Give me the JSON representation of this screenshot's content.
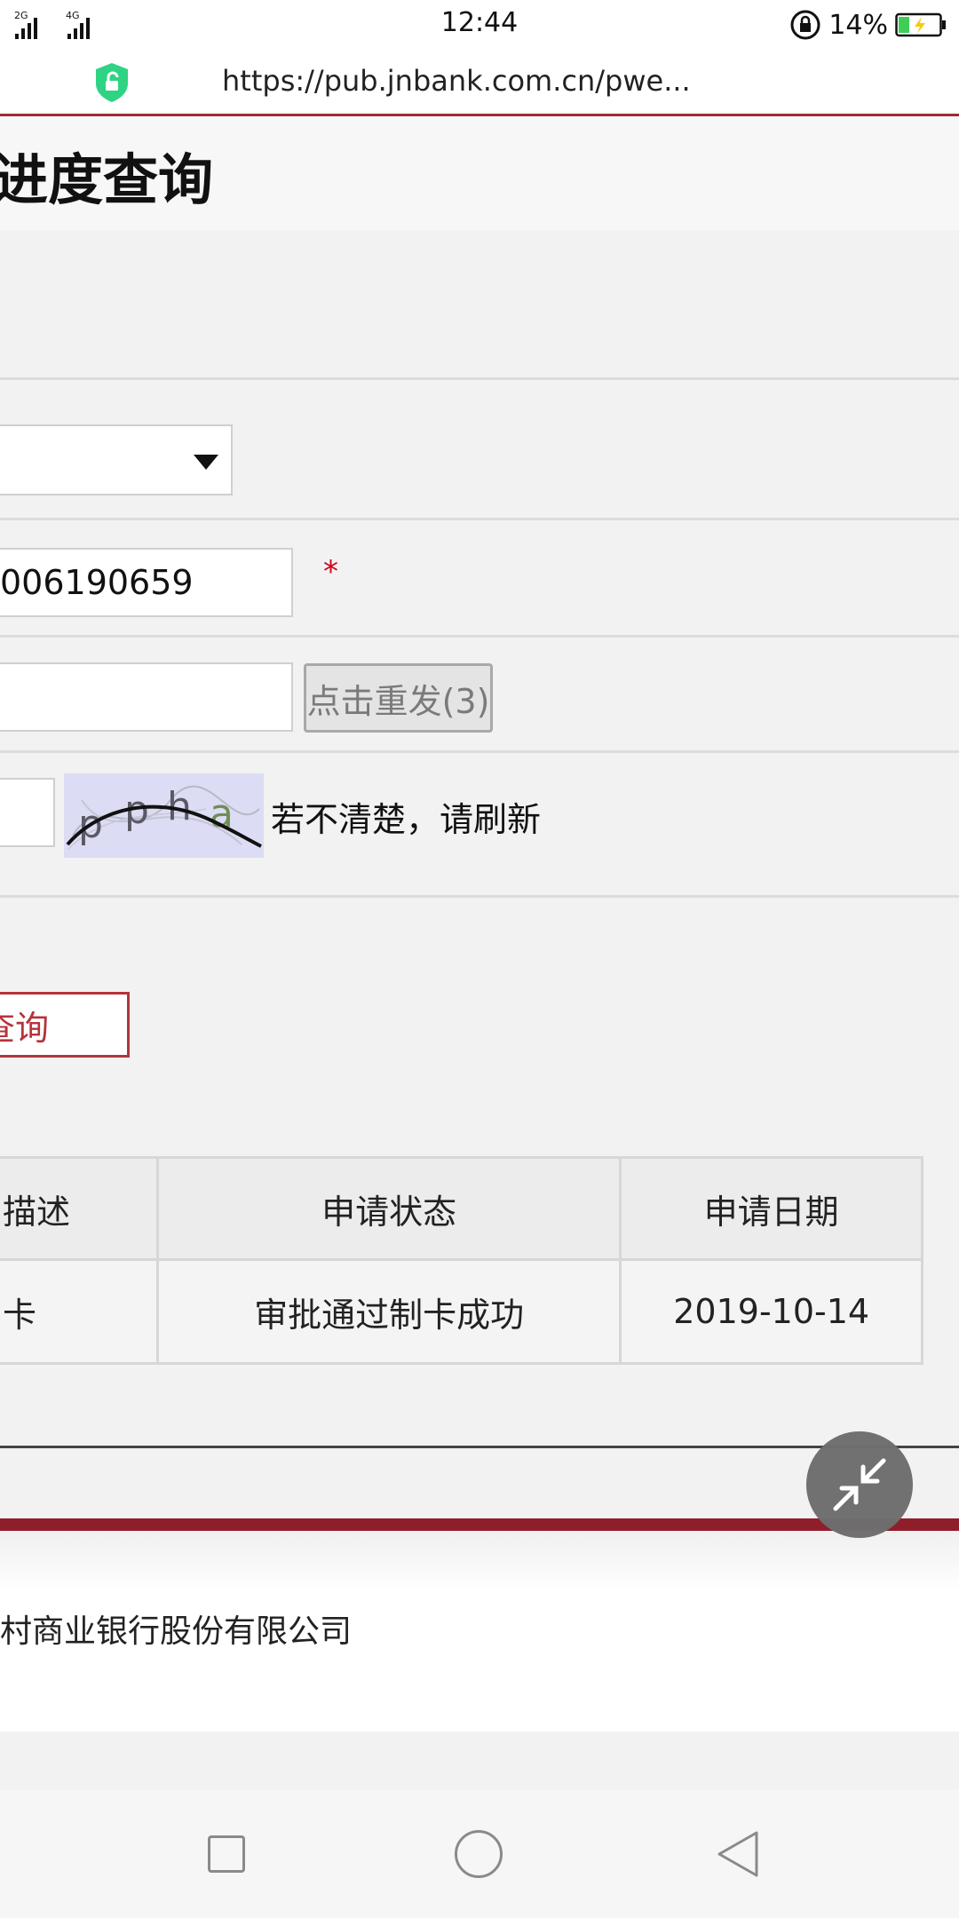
{
  "status_bar": {
    "network_1": "2G",
    "network_2": "4G",
    "time": "12:44",
    "battery_percent": "14%"
  },
  "browser": {
    "url": "https://pub.jnbank.com.cn/pwe..."
  },
  "page": {
    "title": "进度查询",
    "phone_value": "006190659",
    "required_mark": "*",
    "resend_label": "点击重发(3)",
    "refresh_hint": "若不清楚，请刷新",
    "query_label": "查询"
  },
  "table": {
    "headers": [
      "描述",
      "申请状态",
      "申请日期"
    ],
    "rows": [
      [
        "卡",
        "审批通过制卡成功",
        "2019-10-14"
      ]
    ]
  },
  "footer": {
    "text": "村商业银行股份有限公司"
  },
  "colors": {
    "accent_red": "#b8323a",
    "bar_red": "#8e1f2a",
    "shield_green": "#2fd384"
  }
}
